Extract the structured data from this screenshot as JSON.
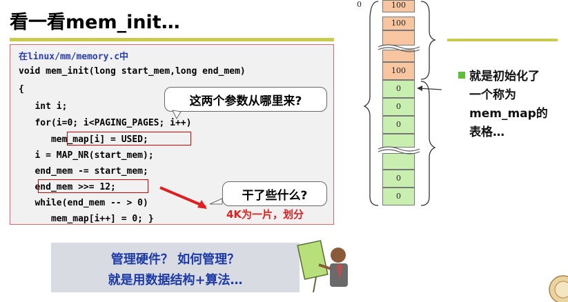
{
  "title": "看一看mem_init…",
  "code": {
    "lines": [
      "在linux/mm/memory.c中",
      "void mem_init(long start_mem,long end_mem)",
      "{",
      "   int i;",
      "   for(i=0; i<PAGING_PAGES; i++)",
      "      mem_map[i] = USED;",
      "   i = MAP_NR(start_mem);",
      "   end_mem -= start_mem;",
      "   end_mem >>= 12;",
      "   while(end_mem -- > 0)",
      "      mem_map[i++] = 0; }"
    ]
  },
  "callouts": {
    "params": "这两个参数从哪里来?",
    "what": "干了些什么?"
  },
  "red_note": "4K为一片，划分",
  "memory": {
    "zero_label": "0",
    "cells": [
      "100",
      "100",
      "100",
      "0",
      "0",
      "0",
      "0",
      "0"
    ]
  },
  "bullet": {
    "lines": [
      "就是初始化了",
      "一个称为",
      "mem_map的",
      "表格…"
    ]
  },
  "bottom": {
    "line1": "管理硬件？ 如何管理？",
    "line2": "就是用数据结构+算法…"
  },
  "colors": {
    "title_rule": "#c9cc4a",
    "code_border": "#e06666",
    "highlight": "#d00000",
    "bullet": "#5fbf3a",
    "bottom_text": "#1c3aa8"
  }
}
